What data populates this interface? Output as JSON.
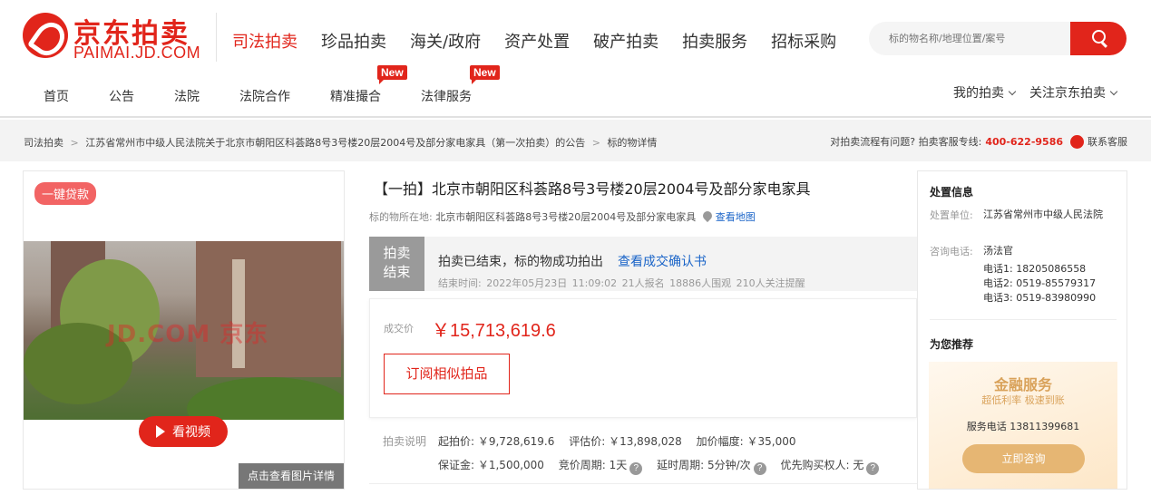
{
  "logo": {
    "cn": "京东拍卖",
    "en": "PAIMAI.JD.COM"
  },
  "main_nav": [
    "司法拍卖",
    "珍品拍卖",
    "海关/政府",
    "资产处置",
    "破产拍卖",
    "拍卖服务",
    "招标采购"
  ],
  "search": {
    "placeholder": "标的物名称/地理位置/案号"
  },
  "sub_nav": [
    {
      "label": "首页",
      "badge": ""
    },
    {
      "label": "公告",
      "badge": ""
    },
    {
      "label": "法院",
      "badge": ""
    },
    {
      "label": "法院合作",
      "badge": ""
    },
    {
      "label": "精准撮合",
      "badge": "New"
    },
    {
      "label": "法律服务",
      "badge": "New"
    }
  ],
  "user_links": {
    "my_auction": "我的拍卖",
    "follow": "关注京东拍卖"
  },
  "breadcrumb": {
    "items": [
      "司法拍卖",
      "江苏省常州市中级人民法院关于北京市朝阳区科荟路8号3号楼20层2004号及部分家电家具（第一次拍卖）的公告",
      "标的物详情"
    ],
    "separator": ">"
  },
  "service": {
    "question": "对拍卖流程有问题? 拍卖客服专线:",
    "phone": "400-622-9586",
    "contact": "联系客服"
  },
  "gallery": {
    "loan_tag": "一键贷款",
    "watermark": "JD.COM 京东",
    "video_label": "看视频",
    "detail_label": "点击查看图片详情"
  },
  "item": {
    "title": "【一拍】北京市朝阳区科荟路8号3号楼20层2004号及部分家电家具",
    "location_label": "标的物所在地:",
    "location": "北京市朝阳区科荟路8号3号楼20层2004号及部分家电家具",
    "map_link": "查看地图",
    "status_tag_1": "拍卖",
    "status_tag_2": "结束",
    "status_text": "拍卖已结束，标的物成功拍出",
    "confirm_link": "查看成交确认书",
    "end_time": "结束时间:  2022年05月23日 11:09:02  21人报名  18886人围观  210人关注提醒",
    "deal_label": "成交价",
    "deal_price": "￥15,713,619.6",
    "subscribe": "订阅相似拍品"
  },
  "rules": {
    "label": "拍卖说明",
    "start_price": "起拍价: ￥9,728,619.6",
    "appraisal": "评估价: ￥13,898,028",
    "increment": "加价幅度: ￥35,000",
    "deposit": "保证金: ￥1,500,000",
    "bid_period": "竞价周期: 1天",
    "delay": "延时周期: 5分钟/次",
    "priority": "优先购买权人: 无"
  },
  "disposal": {
    "title": "处置信息",
    "unit_label": "处置单位:",
    "unit": "江苏省常州市中级人民法院",
    "consult_label": "咨询电话:",
    "contact_name": "汤法官",
    "phones": [
      "电话1: 18205086558",
      "电话2: 0519-85579317",
      "电话3: 0519-83980990"
    ]
  },
  "recommend": {
    "title": "为您推荐",
    "promo_title": "金融服务",
    "promo_sub": "超低利率 极速到账",
    "promo_phone": "服务电话 13811399681",
    "promo_button": "立即咨询"
  },
  "colors": {
    "brand_red": "#e1251b",
    "link_blue": "#1a64c8",
    "gold": "#e6b673"
  }
}
